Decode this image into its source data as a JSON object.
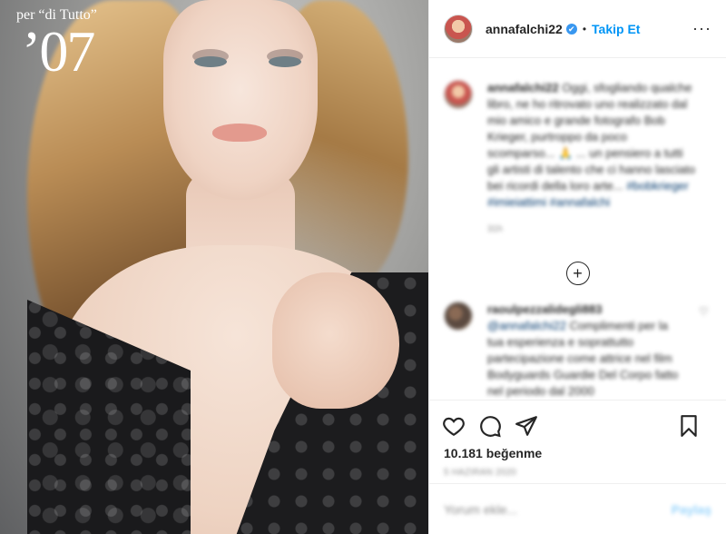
{
  "photo": {
    "magazine_tagline": "per “di Tutto”",
    "magazine_year": "’07"
  },
  "header": {
    "username": "annafalchi22",
    "verified_icon": "✔",
    "separator": "•",
    "follow_label": "Takip Et",
    "more_label": "···"
  },
  "caption": {
    "username": "annafalchi22",
    "text": "Oggi, sfogliando qualche libro, ne ho ritrovato uno realizzato dal mio amico e grande fotografo Bob Krieger, purtroppo da poco scomparso... 🙏 ... un pensiero a tutti gli artisti di talento che ci hanno lasciato bei ricordi della loro arte...",
    "hashtags": "#bobkrieger #imieiattimi #annafalchi",
    "time": "31h"
  },
  "load_more_icon": "+",
  "comments": [
    {
      "username": "raoulpezzalidegli883",
      "mention": "@annafalchi22",
      "text": "Complimenti per la tua esperienza e soprattutto partecipazione come attrice nel film Bodyguards Guardie Del Corpo fatto nel periodo dal 2000",
      "heart": "♡"
    }
  ],
  "actions": {
    "like_icon": "heart-icon",
    "comment_icon": "comment-icon",
    "share_icon": "share-icon",
    "save_icon": "bookmark-icon",
    "likes_text": "10.181 beğenme",
    "date_text": "5 Haziran 2020"
  },
  "comment_box": {
    "placeholder": "Yorum ekle...",
    "post_label": "Paylaş"
  }
}
